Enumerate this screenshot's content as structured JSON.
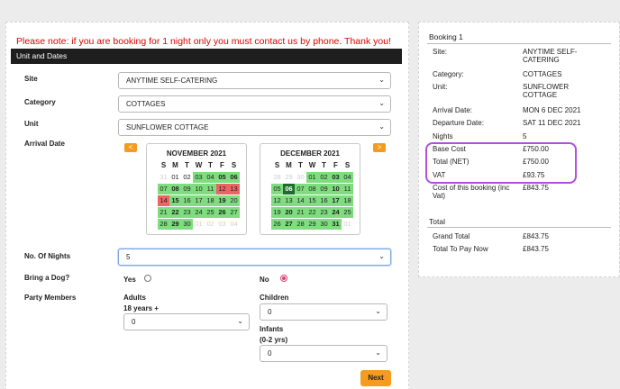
{
  "notice": "Please note: if you are booking for 1 night only you must contact us by phone. Thank you!",
  "section_header": "Unit and Dates",
  "form": {
    "site_label": "Site",
    "site_value": "ANYTIME SELF-CATERING",
    "category_label": "Category",
    "category_value": "COTTAGES",
    "unit_label": "Unit",
    "unit_value": "SUNFLOWER COTTAGE",
    "arrival_label": "Arrival Date",
    "nights_label": "No. Of Nights",
    "nights_value": "5",
    "dog_label": "Bring a Dog?",
    "dog_yes": "Yes",
    "dog_no": "No",
    "dog_selected": "No",
    "party_label": "Party Members",
    "adults_label": "Adults",
    "adults_sub": "18 years +",
    "adults_value": "0",
    "children_label": "Children",
    "children_value": "0",
    "infants_label": "Infants",
    "infants_sub": "(0-2 yrs)",
    "infants_value": "0",
    "next_label": "Next"
  },
  "calendar": {
    "prev": "<",
    "next": ">",
    "days_of_week": [
      "S",
      "M",
      "T",
      "W",
      "T",
      "F",
      "S"
    ],
    "months": [
      {
        "title": "NOVEMBER 2021",
        "weeks": [
          [
            [
              "31",
              "f"
            ],
            [
              "01",
              ""
            ],
            [
              "02",
              ""
            ],
            [
              "03",
              "g"
            ],
            [
              "04",
              "g"
            ],
            [
              "05",
              "gb"
            ],
            [
              "06",
              "gb"
            ]
          ],
          [
            [
              "07",
              "g"
            ],
            [
              "08",
              "gb"
            ],
            [
              "09",
              "g"
            ],
            [
              "10",
              "g"
            ],
            [
              "11",
              "g"
            ],
            [
              "12",
              "r"
            ],
            [
              "13",
              "r"
            ]
          ],
          [
            [
              "14",
              "r"
            ],
            [
              "15",
              "gb"
            ],
            [
              "16",
              "g"
            ],
            [
              "17",
              "g"
            ],
            [
              "18",
              "g"
            ],
            [
              "19",
              "gb"
            ],
            [
              "20",
              "g"
            ]
          ],
          [
            [
              "21",
              "g"
            ],
            [
              "22",
              "gb"
            ],
            [
              "23",
              "g"
            ],
            [
              "24",
              "g"
            ],
            [
              "25",
              "g"
            ],
            [
              "26",
              "gb"
            ],
            [
              "27",
              "g"
            ]
          ],
          [
            [
              "28",
              "g"
            ],
            [
              "29",
              "gb"
            ],
            [
              "30",
              "g"
            ],
            [
              "01",
              "f"
            ],
            [
              "02",
              "f"
            ],
            [
              "03",
              "f"
            ],
            [
              "04",
              "f"
            ]
          ]
        ]
      },
      {
        "title": "DECEMBER 2021",
        "weeks": [
          [
            [
              "28",
              "f"
            ],
            [
              "29",
              "f"
            ],
            [
              "30",
              "f"
            ],
            [
              "01",
              "g"
            ],
            [
              "02",
              "g"
            ],
            [
              "03",
              "gb"
            ],
            [
              "04",
              "g"
            ]
          ],
          [
            [
              "05",
              "g"
            ],
            [
              "06",
              "today"
            ],
            [
              "07",
              "g"
            ],
            [
              "08",
              "g"
            ],
            [
              "09",
              "g"
            ],
            [
              "10",
              "gb"
            ],
            [
              "11",
              "g"
            ]
          ],
          [
            [
              "12",
              "g"
            ],
            [
              "13",
              "g"
            ],
            [
              "14",
              "g"
            ],
            [
              "15",
              "g"
            ],
            [
              "16",
              "g"
            ],
            [
              "17",
              "gb"
            ],
            [
              "18",
              "g"
            ]
          ],
          [
            [
              "19",
              "g"
            ],
            [
              "20",
              "gb"
            ],
            [
              "21",
              "g"
            ],
            [
              "22",
              "g"
            ],
            [
              "23",
              "g"
            ],
            [
              "24",
              "gb"
            ],
            [
              "25",
              "g"
            ]
          ],
          [
            [
              "26",
              "g"
            ],
            [
              "27",
              "gb"
            ],
            [
              "28",
              "g"
            ],
            [
              "29",
              "g"
            ],
            [
              "30",
              "g"
            ],
            [
              "31",
              "gb"
            ],
            [
              "01",
              "f"
            ]
          ]
        ]
      }
    ]
  },
  "summary": {
    "booking_title": "Booking 1",
    "rows": [
      {
        "k": "Site:",
        "v": "ANYTIME SELF-CATERING"
      },
      {
        "k": "Category:",
        "v": "COTTAGES"
      },
      {
        "k": "Unit:",
        "v": "SUNFLOWER COTTAGE"
      },
      {
        "k": "Arrival Date:",
        "v": "MON 6 DEC 2021"
      },
      {
        "k": "Departure Date:",
        "v": "SAT 11 DEC 2021"
      },
      {
        "k": "Nights",
        "v": "5"
      },
      {
        "k": "Base Cost",
        "v": "£750.00"
      },
      {
        "k": "Total (NET)",
        "v": "£750.00"
      },
      {
        "k": "VAT",
        "v": "£93.75"
      },
      {
        "k": "Cost of this booking (inc Vat)",
        "v": "£843.75"
      }
    ],
    "total_title": "Total",
    "totals": [
      {
        "k": "Grand Total",
        "v": "£843.75"
      },
      {
        "k": "Total To Pay Now",
        "v": "£843.75"
      }
    ]
  },
  "colors": {
    "notice": "#e00000",
    "available": "#7fdd7f",
    "unavailable": "#ec6464",
    "selected": "#1f6b2e",
    "accent": "#f39c1f",
    "highlight": "#b050e0"
  }
}
